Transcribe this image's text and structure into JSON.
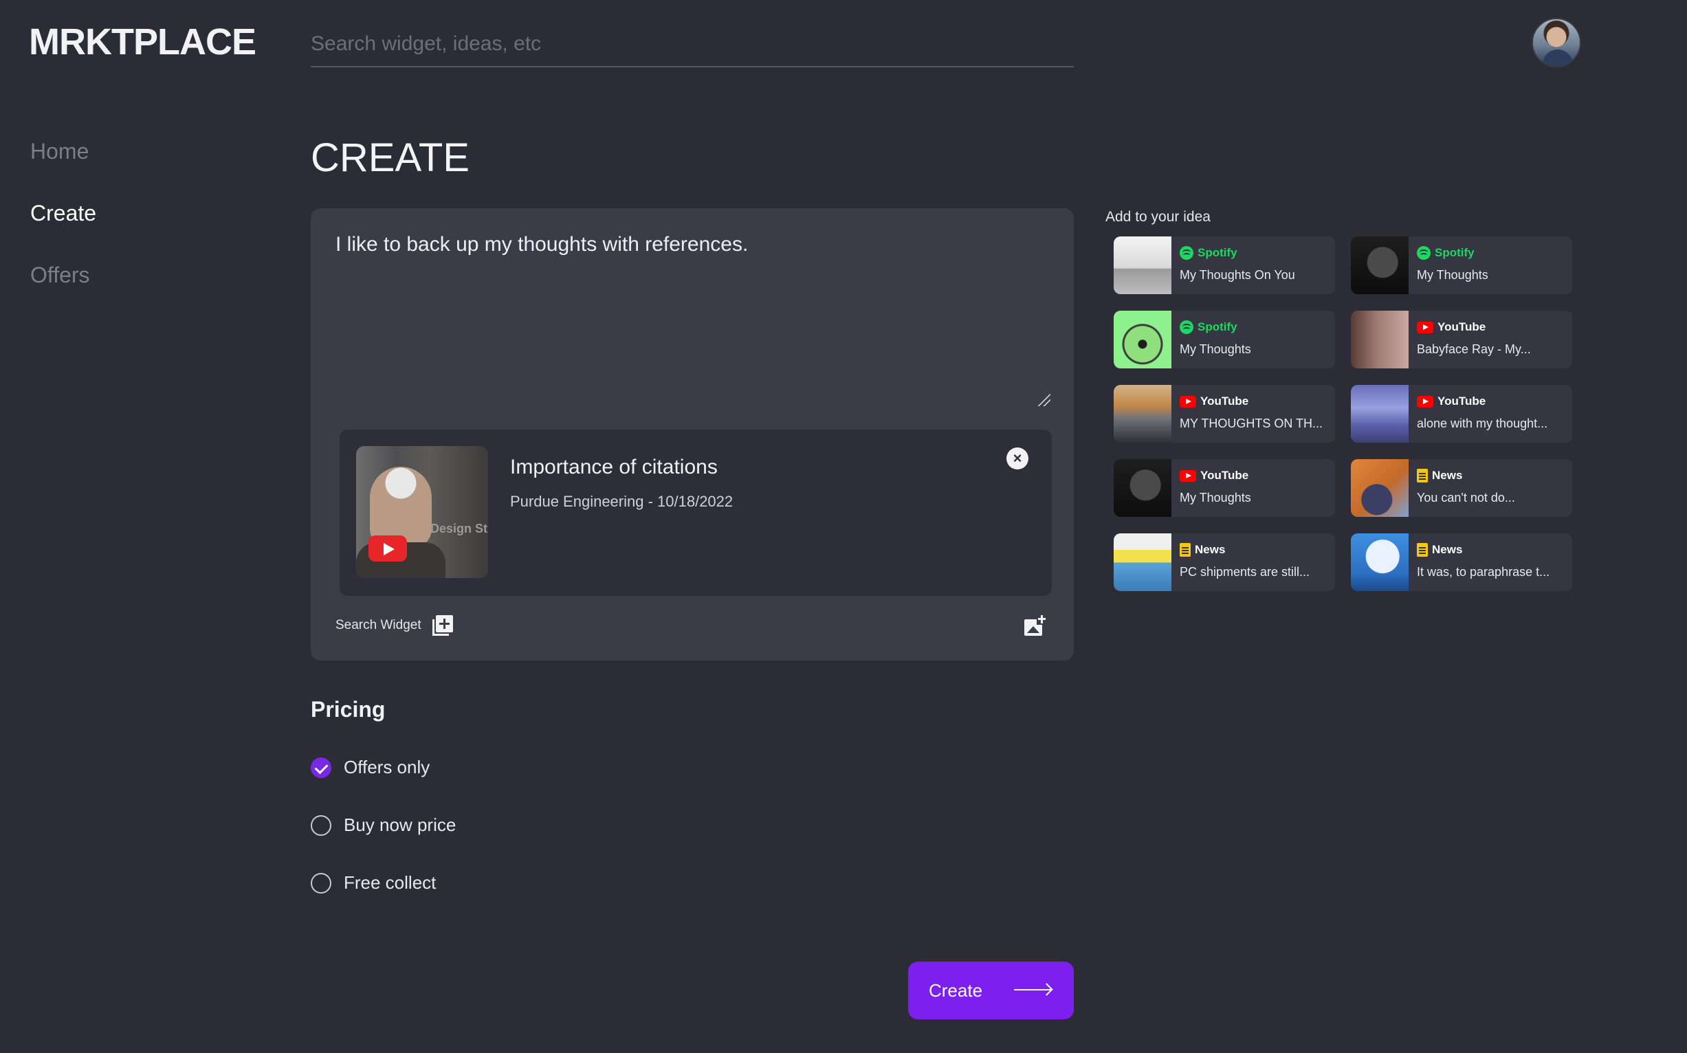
{
  "app": {
    "logo": "MRKTPLACE"
  },
  "search": {
    "placeholder": "Search widget, ideas, etc"
  },
  "nav": {
    "items": [
      "Home",
      "Create",
      "Offers"
    ],
    "active": "Create"
  },
  "page": {
    "title": "CREATE"
  },
  "editor": {
    "text": "I like to back up my thoughts with references.",
    "widget": {
      "title": "Importance of citations",
      "subtitle": "Purdue Engineering - 10/18/2022",
      "thumb_text": "Design Stu"
    },
    "search_widget_label": "Search Widget"
  },
  "pricing": {
    "title": "Pricing",
    "options": [
      {
        "label": "Offers only",
        "checked": true
      },
      {
        "label": "Buy now price",
        "checked": false
      },
      {
        "label": "Free collect",
        "checked": false
      }
    ]
  },
  "create_button": {
    "label": "Create"
  },
  "suggestions": {
    "title": "Add to your idea",
    "items": [
      {
        "source": "Spotify",
        "name": "My Thoughts On You"
      },
      {
        "source": "Spotify",
        "name": "My Thoughts"
      },
      {
        "source": "Spotify",
        "name": "My Thoughts"
      },
      {
        "source": "YouTube",
        "name": "Babyface Ray - My..."
      },
      {
        "source": "YouTube",
        "name": "MY THOUGHTS ON TH..."
      },
      {
        "source": "YouTube",
        "name": "alone with my thought..."
      },
      {
        "source": "YouTube",
        "name": "My Thoughts"
      },
      {
        "source": "News",
        "name": "You can't not do..."
      },
      {
        "source": "News",
        "name": "PC shipments are still..."
      },
      {
        "source": "News",
        "name": "It was, to paraphrase t..."
      }
    ]
  },
  "colors": {
    "background": "#2b2c36",
    "panel": "#3b3c48",
    "accent": "#7d1fee",
    "spotify": "#1ed760",
    "youtube": "#ff0000",
    "news": "#f5c518"
  }
}
